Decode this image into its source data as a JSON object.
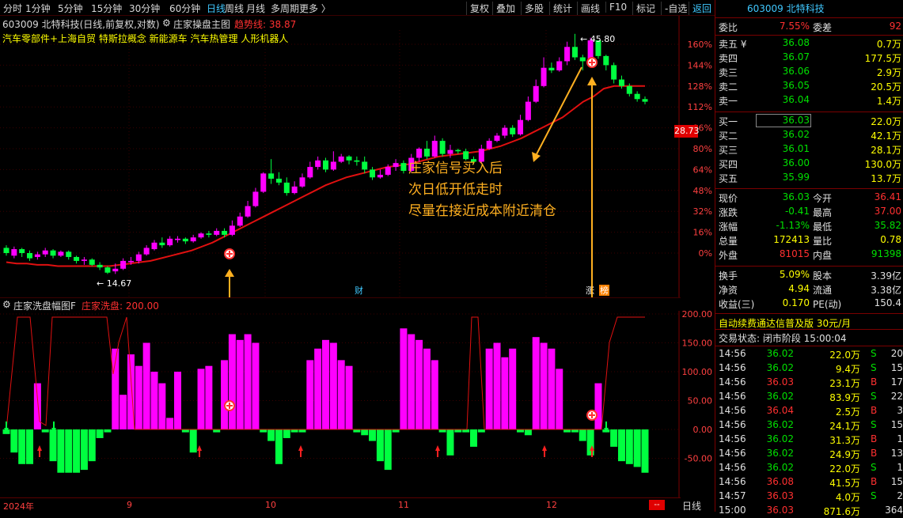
{
  "toolbar": {
    "left_tabs": [
      "分时",
      "1分钟",
      "5分钟",
      "15分钟",
      "30分钟",
      "60分钟",
      "日线",
      "周线",
      "月线",
      "多周期",
      "更多 〉"
    ],
    "active_tab": "日线",
    "right_buttons": [
      "复权",
      "叠加",
      "多股",
      "统计",
      "画线",
      "F10",
      "标记",
      "-自选",
      "返回"
    ]
  },
  "chart_title": {
    "code_name": "603009 北特科技(日线,前复权,对数)",
    "indicator": "庄家操盘主图",
    "trend_label": "趋势线: 38.87"
  },
  "concepts": "汽车零部件+上海自贸 特斯拉概念 新能源车 汽车热管理 人形机器人",
  "price_axis": [
    "160%",
    "144%",
    "128%",
    "112%",
    "96%",
    "80%",
    "64%",
    "48%",
    "32%",
    "16%",
    "0%"
  ],
  "last_price_tag": "28.73",
  "high_label": "45.80",
  "low_label": "14.67",
  "main_markers": {
    "cai": "财",
    "zhang": "涨",
    "bang": "榜"
  },
  "annotation_lines": [
    "庄家信号买入后",
    "次日低开低走时",
    "尽量在接近成本附近清仓"
  ],
  "indicator_panel": {
    "name": "庄家洗盘幅图F",
    "value_label": "庄家洗盘: 200.00",
    "axis": [
      "200.00",
      "150.00",
      "100.00",
      "50.00",
      "0.00",
      "-50.00"
    ]
  },
  "x_axis": [
    "2024年",
    "9",
    "10",
    "11",
    "12"
  ],
  "bottom": {
    "period": "日线",
    "red_tag": "--"
  },
  "chart_data": {
    "type": "candlestick",
    "title": "603009 北特科技(日线,前复权,对数)",
    "indicator_series": "庄家洗盘",
    "price_range_pct": [
      0,
      160
    ],
    "indicator_range": [
      -80,
      200
    ],
    "candles": [
      [
        0,
        4,
        -2,
        6,
        0
      ],
      [
        -2,
        3,
        -4,
        5,
        1
      ],
      [
        3,
        0,
        -3,
        4,
        0
      ],
      [
        0,
        -4,
        -6,
        2,
        0
      ],
      [
        -3,
        -1,
        -5,
        1,
        1
      ],
      [
        -1,
        2,
        -3,
        4,
        1
      ],
      [
        2,
        -2,
        -4,
        3,
        0
      ],
      [
        -2,
        1,
        -3,
        2,
        1
      ],
      [
        1,
        -3,
        -5,
        2,
        0
      ],
      [
        -3,
        -6,
        -8,
        -2,
        0
      ],
      [
        -6,
        -5,
        -9,
        -3,
        1
      ],
      [
        -5,
        -9,
        -10,
        -4,
        0
      ],
      [
        -9,
        -11,
        -13,
        -7,
        0
      ],
      [
        -11,
        -15,
        -16,
        -10,
        0
      ],
      [
        -14,
        -12,
        -16,
        -8,
        1
      ],
      [
        -12,
        -6,
        -13,
        -4,
        1
      ],
      [
        -7,
        -6,
        -9,
        -3,
        1
      ],
      [
        -6,
        -1,
        -8,
        1,
        1
      ],
      [
        -1,
        4,
        -2,
        6,
        1
      ],
      [
        3,
        8,
        2,
        10,
        1
      ],
      [
        8,
        6,
        4,
        12,
        0
      ],
      [
        6,
        11,
        5,
        13,
        1
      ],
      [
        10,
        11,
        8,
        13,
        1
      ],
      [
        11,
        9,
        7,
        12,
        0
      ],
      [
        9,
        12,
        8,
        14,
        1
      ],
      [
        12,
        15,
        11,
        16,
        1
      ],
      [
        15,
        14,
        12,
        17,
        0
      ],
      [
        14,
        17,
        13,
        19,
        1
      ],
      [
        17,
        14,
        12,
        19,
        0
      ],
      [
        14,
        21,
        13,
        25,
        1
      ],
      [
        21,
        28,
        20,
        31,
        1
      ],
      [
        28,
        36,
        27,
        40,
        1
      ],
      [
        36,
        47,
        35,
        50,
        1
      ],
      [
        47,
        61,
        46,
        62,
        1
      ],
      [
        61,
        57,
        53,
        72,
        0
      ],
      [
        57,
        54,
        52,
        62,
        0
      ],
      [
        54,
        46,
        44,
        58,
        0
      ],
      [
        46,
        51,
        45,
        55,
        1
      ],
      [
        51,
        58,
        50,
        61,
        1
      ],
      [
        58,
        66,
        57,
        70,
        1
      ],
      [
        66,
        71,
        64,
        74,
        1
      ],
      [
        71,
        64,
        62,
        73,
        0
      ],
      [
        64,
        70,
        63,
        78,
        1
      ],
      [
        70,
        74,
        69,
        76,
        1
      ],
      [
        74,
        71,
        68,
        75,
        0
      ],
      [
        71,
        70,
        67,
        74,
        0
      ],
      [
        70,
        64,
        61,
        74,
        0
      ],
      [
        64,
        58,
        56,
        66,
        0
      ],
      [
        58,
        60,
        57,
        64,
        1
      ],
      [
        60,
        66,
        59,
        68,
        1
      ],
      [
        66,
        69,
        63,
        72,
        1
      ],
      [
        69,
        63,
        61,
        71,
        0
      ],
      [
        63,
        73,
        62,
        76,
        1
      ],
      [
        73,
        80,
        70,
        81,
        1
      ],
      [
        80,
        74,
        72,
        86,
        0
      ],
      [
        74,
        86,
        73,
        90,
        1
      ],
      [
        86,
        76,
        74,
        88,
        0
      ],
      [
        76,
        79,
        73,
        83,
        1
      ],
      [
        79,
        78,
        76,
        80,
        0
      ],
      [
        78,
        72,
        71,
        80,
        0
      ],
      [
        72,
        70,
        68,
        74,
        0
      ],
      [
        70,
        80,
        69,
        83,
        1
      ],
      [
        80,
        86,
        79,
        88,
        1
      ],
      [
        86,
        90,
        85,
        92,
        1
      ],
      [
        90,
        96,
        88,
        98,
        1
      ],
      [
        96,
        91,
        89,
        98,
        0
      ],
      [
        91,
        102,
        90,
        106,
        1
      ],
      [
        102,
        116,
        101,
        120,
        1
      ],
      [
        116,
        128,
        115,
        133,
        1
      ],
      [
        128,
        142,
        127,
        150,
        1
      ],
      [
        142,
        140,
        138,
        146,
        0
      ],
      [
        140,
        147,
        139,
        150,
        1
      ],
      [
        147,
        158,
        144,
        162,
        1
      ],
      [
        158,
        150,
        148,
        168,
        0
      ],
      [
        150,
        147,
        140,
        152,
        0
      ],
      [
        147,
        163,
        145,
        165,
        1
      ],
      [
        163,
        151,
        149,
        162,
        0
      ],
      [
        151,
        144,
        140,
        152,
        0
      ],
      [
        144,
        133,
        130,
        146,
        0
      ],
      [
        133,
        128,
        126,
        136,
        0
      ],
      [
        128,
        122,
        120,
        130,
        0
      ],
      [
        122,
        118,
        116,
        124,
        0
      ],
      [
        118,
        116,
        114,
        120,
        0
      ]
    ],
    "indicator_values": [
      -8,
      -40,
      -60,
      -60,
      80,
      -5,
      -55,
      -75,
      -75,
      -75,
      -70,
      -55,
      -15,
      -5,
      140,
      60,
      130,
      110,
      150,
      100,
      80,
      20,
      100,
      -5,
      -40,
      105,
      110,
      -5,
      120,
      165,
      155,
      165,
      150,
      -5,
      -20,
      -60,
      -15,
      -5,
      -5,
      120,
      140,
      155,
      150,
      120,
      110,
      -5,
      -10,
      -20,
      -55,
      -70,
      -5,
      175,
      165,
      155,
      140,
      120,
      -5,
      -45,
      -5,
      -5,
      -30,
      -5,
      140,
      150,
      125,
      140,
      -5,
      -10,
      160,
      150,
      140,
      105,
      -5,
      -5,
      -20,
      -45,
      80,
      -5,
      -30,
      -55,
      -60,
      -65,
      -75
    ],
    "trend_line_pct": [
      -7,
      -8,
      -8,
      -9,
      -9,
      -10,
      -10,
      -10,
      -10,
      -10,
      -10,
      -9,
      -8,
      -7,
      -6,
      -4,
      -2,
      0,
      2,
      5,
      8,
      12,
      16,
      20,
      24,
      28,
      32,
      36,
      40,
      44,
      48,
      52,
      55,
      58,
      60,
      62,
      64,
      66,
      67,
      68,
      70,
      72,
      74,
      75,
      76,
      77,
      78,
      80,
      82,
      85,
      88,
      92,
      96,
      100,
      104,
      110,
      116,
      120,
      126,
      128,
      128,
      128,
      128
    ]
  }
}
